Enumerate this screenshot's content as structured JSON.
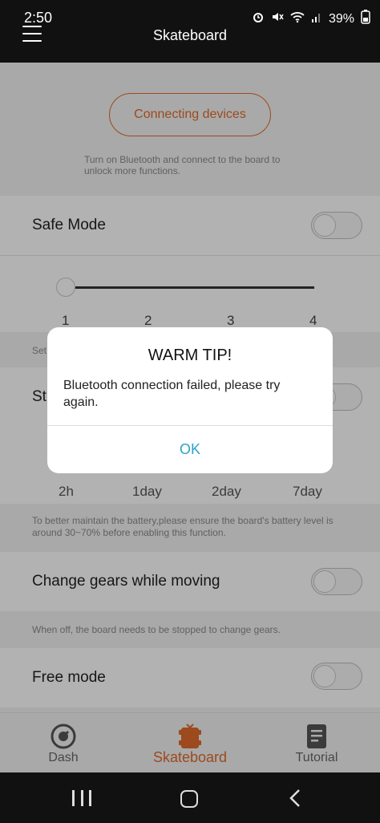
{
  "status_bar": {
    "time": "2:50",
    "battery": "39%",
    "icons": [
      "alarm-icon",
      "mute-icon",
      "wifi-icon",
      "signal-icon",
      "battery-icon"
    ]
  },
  "header": {
    "title": "Skateboard"
  },
  "connection": {
    "button_label": "Connecting devices",
    "hint": "Turn on Bluetooth and connect to the board to unlock more functions."
  },
  "safe_mode": {
    "label": "Safe Mode",
    "enabled": false,
    "slider_value": 1,
    "ticks": [
      "1",
      "2",
      "3",
      "4"
    ],
    "note_partial": "Set"
  },
  "storage": {
    "label_partial": "St",
    "options": [
      "2h",
      "1day",
      "2day",
      "7day"
    ],
    "note": "To better maintain the battery,please ensure the board's battery level is around 30~70% before enabling this function."
  },
  "change_gears": {
    "label": "Change gears while moving",
    "enabled": false,
    "note": "When off, the board needs to be stopped to change gears."
  },
  "free_mode": {
    "label": "Free mode",
    "enabled": false
  },
  "dialog": {
    "title": "WARM TIP!",
    "message": "Bluetooth connection failed, please try again.",
    "ok_label": "OK"
  },
  "tabs": [
    {
      "label": "Dash",
      "icon": "dash-icon",
      "active": false
    },
    {
      "label": "Skateboard",
      "icon": "skateboard-icon",
      "active": true
    },
    {
      "label": "Tutorial",
      "icon": "tutorial-icon",
      "active": false
    }
  ],
  "colors": {
    "accent": "#e06a2b",
    "dialog_button": "#2aa4c7"
  }
}
